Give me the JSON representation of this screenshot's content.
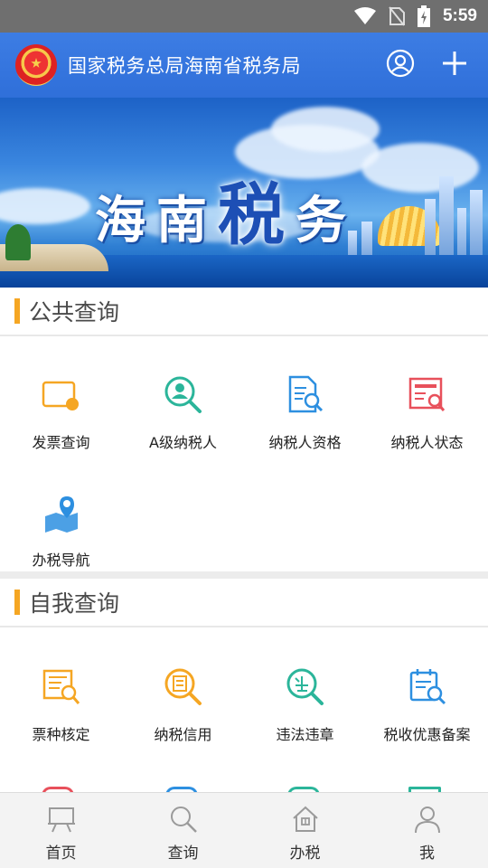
{
  "status_bar": {
    "time": "5:59",
    "icons": [
      "wifi-icon",
      "no-sim-icon",
      "battery-charging-icon"
    ]
  },
  "header": {
    "title": "国家税务总局海南省税务局",
    "actions": [
      {
        "icon": "user-circle-icon"
      },
      {
        "icon": "plus-icon"
      }
    ],
    "brand_color": "#3478e0"
  },
  "banner": {
    "title_chars": [
      "海",
      "南",
      "税",
      "务"
    ]
  },
  "sections": [
    {
      "title": "公共查询",
      "items": [
        {
          "label": "发票查询",
          "icon": "invoice-search-icon",
          "color": "#f5a623"
        },
        {
          "label": "A级纳税人",
          "icon": "taxpayer-search-icon",
          "color": "#2bb59a"
        },
        {
          "label": "纳税人资格",
          "icon": "document-search-icon",
          "color": "#2d8fe0"
        },
        {
          "label": "纳税人状态",
          "icon": "status-search-icon",
          "color": "#e8505b"
        },
        {
          "label": "办税导航",
          "icon": "map-pin-icon",
          "color": "#2d8fe0"
        }
      ]
    },
    {
      "title": "自我查询",
      "items": [
        {
          "label": "票种核定",
          "icon": "ticket-verify-icon",
          "color": "#f5a623"
        },
        {
          "label": "纳税信用",
          "icon": "credit-icon",
          "color": "#f5a623"
        },
        {
          "label": "违法违章",
          "icon": "violation-icon",
          "color": "#2bb59a"
        },
        {
          "label": "税收优惠备案",
          "icon": "tax-benefit-icon",
          "color": "#2d8fe0"
        }
      ]
    }
  ],
  "bottom_nav": [
    {
      "label": "首页",
      "icon": "home-board-icon"
    },
    {
      "label": "查询",
      "icon": "search-icon"
    },
    {
      "label": "办税",
      "icon": "house-icon"
    },
    {
      "label": "我",
      "icon": "person-icon"
    }
  ],
  "accent_color": "#f5a623"
}
